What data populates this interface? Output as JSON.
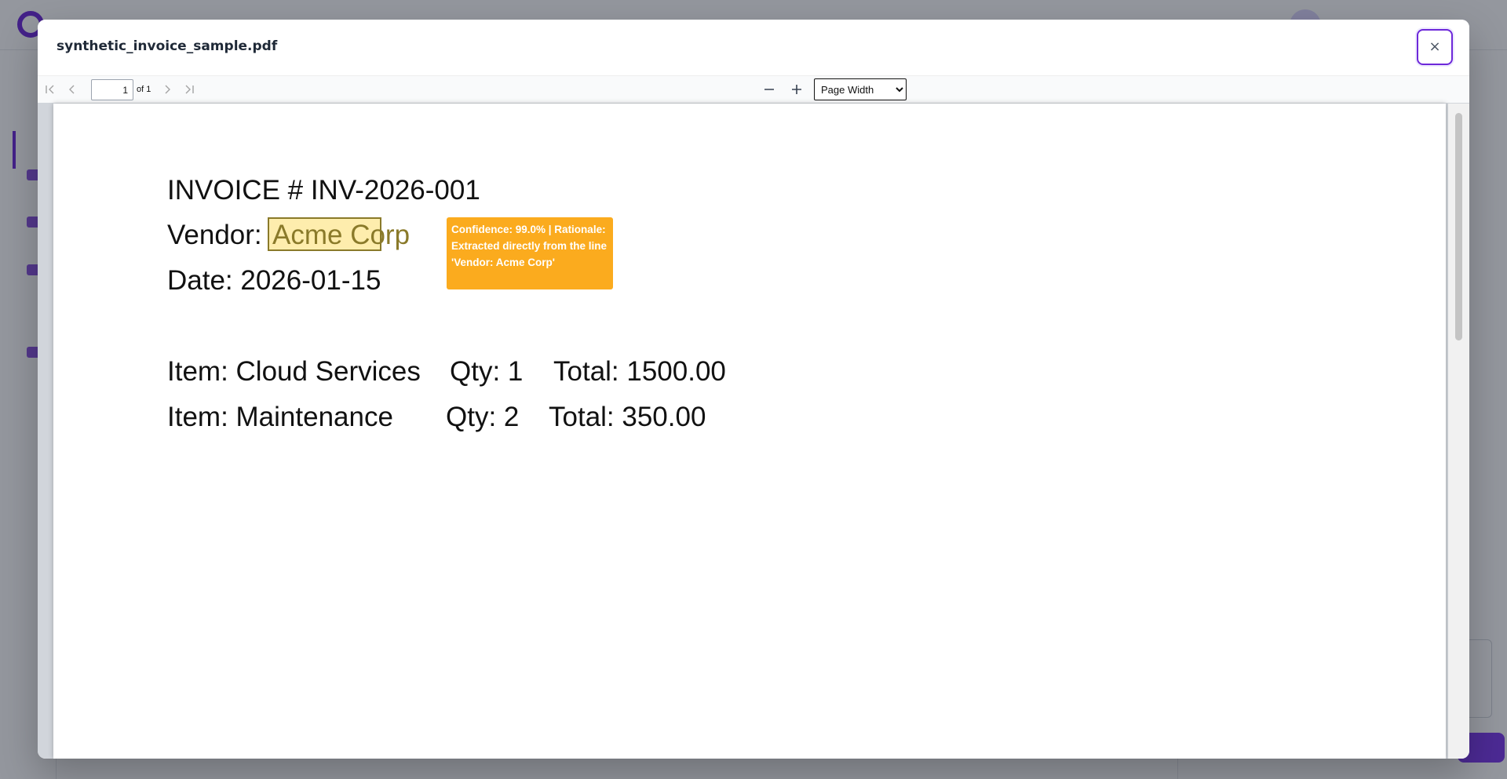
{
  "modal": {
    "title": "synthetic_invoice_sample.pdf",
    "close_label": "×"
  },
  "toolbar": {
    "page_current": "1",
    "page_of": "of 1",
    "zoom_selected": "Page Width",
    "zoom_options": [
      "Page Width"
    ]
  },
  "document": {
    "lines": {
      "invoice": "INVOICE # INV-2026-001",
      "vendor_label": "Vendor:",
      "vendor_value": "Acme Corp",
      "date": "Date: 2026-01-15",
      "item1_name": "Item: Cloud Services",
      "item1_qty": "Qty: 1",
      "item1_total": "Total: 1500.00",
      "item2_name": "Item: Maintenance",
      "item2_qty": "Qty: 2",
      "item2_total": "Total: 350.00"
    },
    "annotation": {
      "text": "Confidence: 99.0% | Rationale: Extracted directly from the line 'Vendor: Acme Corp'",
      "color": "#fbab1e"
    }
  },
  "colors": {
    "accent": "#6d28d9",
    "highlight": "#fde68a"
  }
}
